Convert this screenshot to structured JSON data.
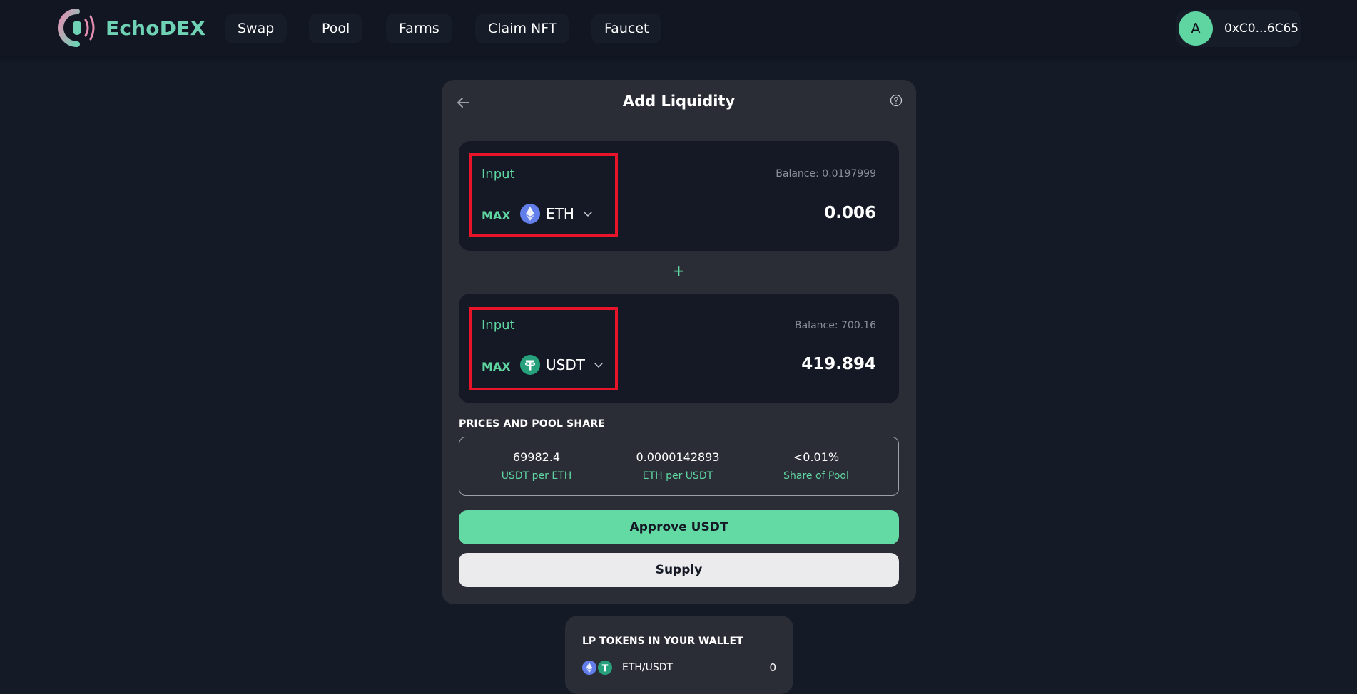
{
  "brand": {
    "name": "EchoDEX",
    "accent": "#6fd2b4"
  },
  "nav": {
    "items": [
      "Swap",
      "Pool",
      "Farms",
      "Claim NFT",
      "Faucet"
    ]
  },
  "account": {
    "avatar_letter": "A",
    "address": "0xC0...6C65",
    "avatar_color": "#5fd6a1"
  },
  "card": {
    "title": "Add Liquidity",
    "inputs": [
      {
        "label": "Input",
        "balance": "Balance: 0.0197999",
        "max_label": "MAX",
        "token": "ETH",
        "amount": "0.006",
        "token_icon": "eth-icon"
      },
      {
        "label": "Input",
        "balance": "Balance: 700.16",
        "max_label": "MAX",
        "token": "USDT",
        "amount": "419.894",
        "token_icon": "usdt-icon"
      }
    ],
    "plus_symbol": "+",
    "prices": {
      "title": "PRICES AND POOL SHARE",
      "items": [
        {
          "value": "69982.4",
          "label": "USDT per ETH"
        },
        {
          "value": "0.0000142893",
          "label": "ETH per USDT"
        },
        {
          "value": "<0.01%",
          "label": "Share of Pool"
        }
      ]
    },
    "approve_label": "Approve USDT",
    "supply_label": "Supply"
  },
  "lp": {
    "title": "LP TOKENS IN YOUR WALLET",
    "pair": "ETH/USDT",
    "balance": "0"
  },
  "colors": {
    "background": "#151a27",
    "header": "#111622",
    "card": "#2b2d36",
    "input_box": "#141925",
    "green": "#5fd6a1",
    "approve_button": "#63d9a3",
    "supply_button": "#ebebed",
    "highlight": "#e8142a"
  }
}
